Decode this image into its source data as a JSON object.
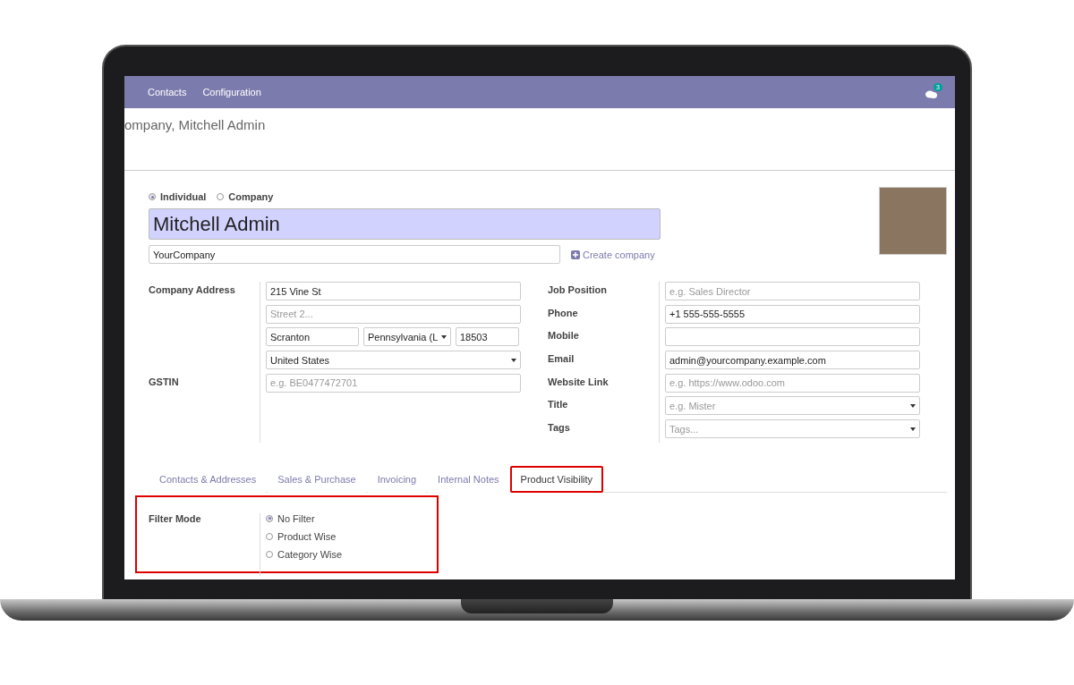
{
  "navbar": {
    "menu": [
      {
        "label": "Contacts"
      },
      {
        "label": "Configuration"
      }
    ],
    "chat_badge": "3"
  },
  "breadcrumb": "ompany, Mitchell Admin",
  "partner_type": [
    {
      "label": "Individual",
      "selected": true
    },
    {
      "label": "Company",
      "selected": false
    }
  ],
  "name": "Mitchell Admin",
  "company": "YourCompany",
  "create_company": "Create company",
  "address": {
    "label": "Company Address",
    "street": "215 Vine St",
    "street2_placeholder": "Street 2...",
    "city": "Scranton",
    "state": "Pennsylvania (L",
    "zip": "18503",
    "country": "United States"
  },
  "gstin": {
    "label": "GSTIN",
    "placeholder": "e.g. BE0477472701"
  },
  "right_fields": [
    {
      "label": "Job Position",
      "kind": "text",
      "placeholder": "e.g. Sales Director"
    },
    {
      "label": "Phone",
      "kind": "text",
      "value": "+1 555-555-5555"
    },
    {
      "label": "Mobile",
      "kind": "text"
    },
    {
      "label": "Email",
      "kind": "text",
      "value": "admin@yourcompany.example.com"
    },
    {
      "label": "Website Link",
      "kind": "text",
      "placeholder": "e.g. https://www.odoo.com"
    },
    {
      "label": "Title",
      "kind": "select",
      "placeholder": "e.g. Mister"
    },
    {
      "label": "Tags",
      "kind": "select",
      "placeholder": "Tags..."
    }
  ],
  "tabs": [
    {
      "label": "Contacts & Addresses",
      "selected": false
    },
    {
      "label": "Sales & Purchase",
      "selected": false
    },
    {
      "label": "Invoicing",
      "selected": false
    },
    {
      "label": "Internal Notes",
      "selected": false
    },
    {
      "label": "Product Visibility",
      "selected": true
    }
  ],
  "filter_mode": {
    "label": "Filter Mode",
    "options": [
      {
        "label": "No Filter",
        "selected": true
      },
      {
        "label": "Product Wise",
        "selected": false
      },
      {
        "label": "Category Wise",
        "selected": false
      }
    ]
  }
}
